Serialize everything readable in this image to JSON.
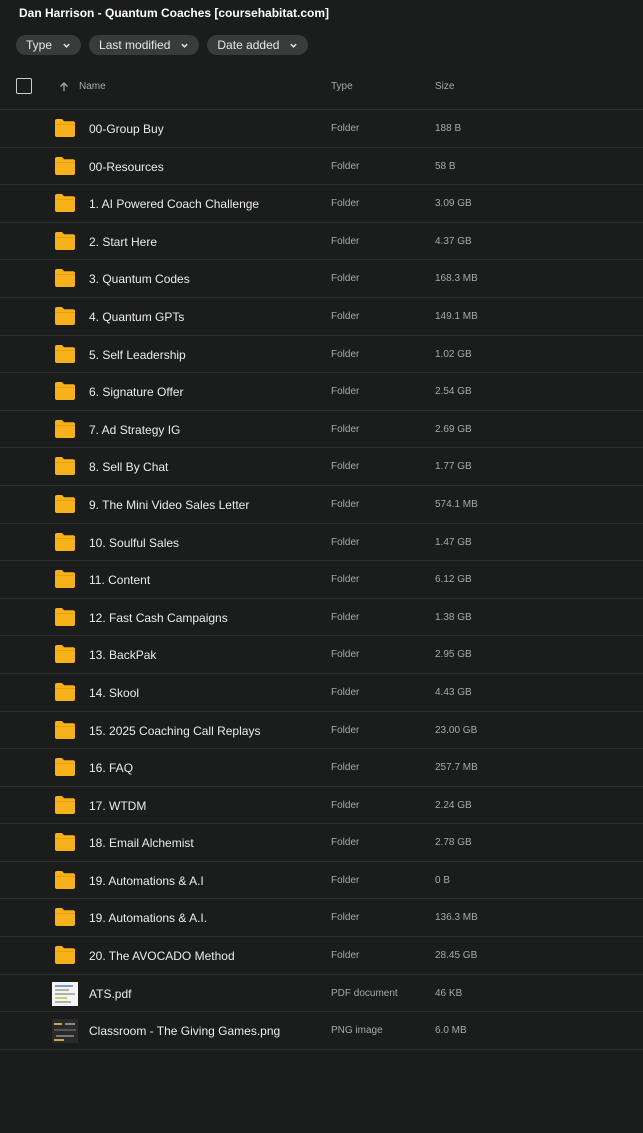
{
  "title": "Dan Harrison - Quantum Coaches [coursehabitat.com]",
  "filters": [
    "Type",
    "Last modified",
    "Date added"
  ],
  "columns": {
    "name": "Name",
    "type": "Type",
    "size": "Size"
  },
  "colors": {
    "background": "#1b1c1c",
    "folder": "#f7b11b",
    "divider": "#303232",
    "chip": "#3a3c3c"
  },
  "files": [
    {
      "name": "00-Group Buy",
      "type": "Folder",
      "size": "188 B",
      "icon": "folder-icon"
    },
    {
      "name": "00-Resources",
      "type": "Folder",
      "size": "58 B",
      "icon": "folder-icon"
    },
    {
      "name": "1. AI Powered Coach Challenge",
      "type": "Folder",
      "size": "3.09 GB",
      "icon": "folder-icon"
    },
    {
      "name": "2. Start Here",
      "type": "Folder",
      "size": "4.37 GB",
      "icon": "folder-icon"
    },
    {
      "name": "3. Quantum Codes",
      "type": "Folder",
      "size": "168.3 MB",
      "icon": "folder-icon"
    },
    {
      "name": "4. Quantum GPTs",
      "type": "Folder",
      "size": "149.1 MB",
      "icon": "folder-icon"
    },
    {
      "name": "5. Self Leadership",
      "type": "Folder",
      "size": "1.02 GB",
      "icon": "folder-icon"
    },
    {
      "name": "6. Signature Offer",
      "type": "Folder",
      "size": "2.54 GB",
      "icon": "folder-icon"
    },
    {
      "name": "7. Ad Strategy IG",
      "type": "Folder",
      "size": "2.69 GB",
      "icon": "folder-icon"
    },
    {
      "name": "8. Sell By Chat",
      "type": "Folder",
      "size": "1.77 GB",
      "icon": "folder-icon"
    },
    {
      "name": "9. The Mini Video Sales Letter",
      "type": "Folder",
      "size": "574.1 MB",
      "icon": "folder-icon"
    },
    {
      "name": "10. Soulful Sales",
      "type": "Folder",
      "size": "1.47 GB",
      "icon": "folder-icon"
    },
    {
      "name": "11. Content",
      "type": "Folder",
      "size": "6.12 GB",
      "icon": "folder-icon"
    },
    {
      "name": "12. Fast Cash Campaigns",
      "type": "Folder",
      "size": "1.38 GB",
      "icon": "folder-icon"
    },
    {
      "name": "13. BackPak",
      "type": "Folder",
      "size": "2.95 GB",
      "icon": "folder-icon"
    },
    {
      "name": "14. Skool",
      "type": "Folder",
      "size": "4.43 GB",
      "icon": "folder-icon"
    },
    {
      "name": "15. 2025 Coaching Call Replays",
      "type": "Folder",
      "size": "23.00 GB",
      "icon": "folder-icon"
    },
    {
      "name": "16. FAQ",
      "type": "Folder",
      "size": "257.7 MB",
      "icon": "folder-icon"
    },
    {
      "name": "17. WTDM",
      "type": "Folder",
      "size": "2.24 GB",
      "icon": "folder-icon"
    },
    {
      "name": "18. Email Alchemist",
      "type": "Folder",
      "size": "2.78 GB",
      "icon": "folder-icon"
    },
    {
      "name": "19. Automations & A.I",
      "type": "Folder",
      "size": "0 B",
      "icon": "folder-icon"
    },
    {
      "name": "19. Automations & A.I.",
      "type": "Folder",
      "size": "136.3 MB",
      "icon": "folder-icon"
    },
    {
      "name": "20. The AVOCADO Method",
      "type": "Folder",
      "size": "28.45 GB",
      "icon": "folder-icon"
    },
    {
      "name": "ATS.pdf",
      "type": "PDF document",
      "size": "46 KB",
      "icon": "pdf-thumbnail"
    },
    {
      "name": "Classroom - The Giving Games.png",
      "type": "PNG image",
      "size": "6.0 MB",
      "icon": "png-thumbnail"
    }
  ]
}
